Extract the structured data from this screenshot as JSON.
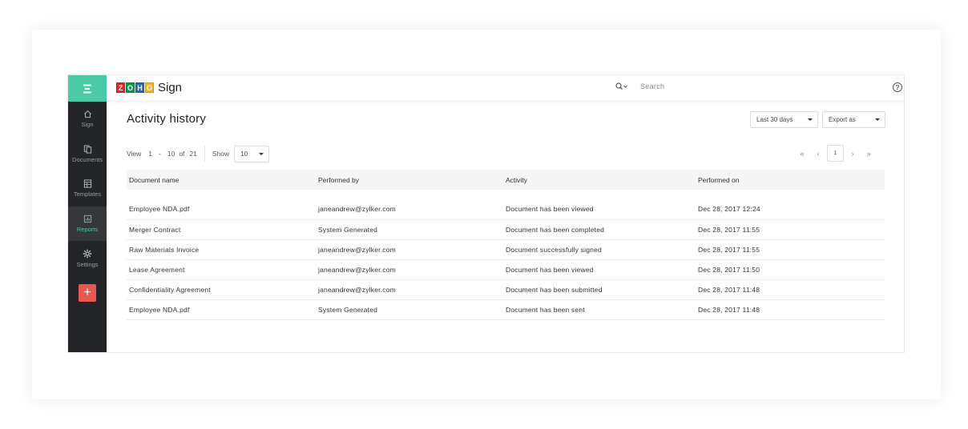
{
  "app": {
    "brand_letters": [
      "Z",
      "O",
      "H",
      "O"
    ],
    "brand_colors": [
      "#e42527",
      "#089949",
      "#226db4",
      "#f9b21d"
    ],
    "brand_name": "Sign"
  },
  "sidebar": {
    "accent": "#4ccaa5",
    "items": [
      {
        "label": "Sign",
        "icon": "home-icon"
      },
      {
        "label": "Documents",
        "icon": "documents-icon"
      },
      {
        "label": "Templates",
        "icon": "templates-icon"
      },
      {
        "label": "Reports",
        "icon": "reports-icon",
        "active": true
      },
      {
        "label": "Settings",
        "icon": "gear-icon"
      }
    ],
    "add_label": "+"
  },
  "topbar": {
    "search_placeholder": "Search",
    "help_label": "?"
  },
  "page": {
    "title": "Activity history",
    "date_filter": "Last 30 days",
    "export": "Export as",
    "view_label": "View",
    "view_from": "1",
    "view_dash": "-",
    "view_to": "10",
    "view_of": "of",
    "view_total": "21",
    "show_label": "Show",
    "show_value": "10",
    "current_page": "1"
  },
  "table": {
    "headers": [
      "Document name",
      "Performed by",
      "Activity",
      "Performed on"
    ],
    "rows": [
      [
        "Employee NDA.pdf",
        "janeandrew@zylker.com",
        "Document has been viewed",
        "Dec 28, 2017 12:24"
      ],
      [
        "Merger Contract",
        "System Generated",
        "Document has been completed",
        "Dec 28, 2017 11:55"
      ],
      [
        "Raw Materials Invoice",
        "janeandrew@zylker.com",
        "Document successfully signed",
        "Dec 28, 2017 11:55"
      ],
      [
        "Lease Agreement",
        "janeandrew@zylker.com",
        "Document has been viewed",
        "Dec 28, 2017 11:50"
      ],
      [
        "Confidentiality Agreement",
        "janeandrew@zylker.com",
        "Document has been submitted",
        "Dec 28, 2017 11:48"
      ],
      [
        "Employee NDA.pdf",
        "System Generated",
        "Document has been sent",
        "Dec 28, 2017 11:48"
      ]
    ]
  }
}
